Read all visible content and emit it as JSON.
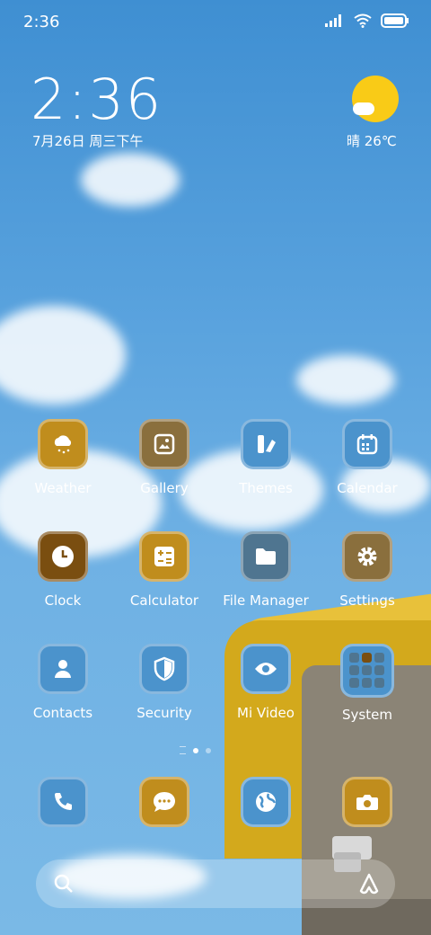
{
  "status_bar": {
    "time": "2:36"
  },
  "clock_widget": {
    "time": "2:36",
    "date": "7月26日 周三下午"
  },
  "weather_widget": {
    "text": "晴 26℃"
  },
  "apps": [
    {
      "label": "Weather",
      "color": "#c08d1d",
      "icon": "cloud-rain-icon"
    },
    {
      "label": "Gallery",
      "color": "#8a6f3d",
      "icon": "image-icon"
    },
    {
      "label": "Themes",
      "color": "#4b93cc",
      "icon": "themes-icon"
    },
    {
      "label": "Calendar",
      "color": "#4b93cc",
      "icon": "calendar-icon"
    },
    {
      "label": "Clock",
      "color": "#7a4e10",
      "icon": "clock-icon"
    },
    {
      "label": "Calculator",
      "color": "#c08d1d",
      "icon": "calculator-icon"
    },
    {
      "label": "File Manager",
      "color": "#4f7590",
      "icon": "folder-icon"
    },
    {
      "label": "Settings",
      "color": "#8a6f3d",
      "icon": "gear-icon"
    },
    {
      "label": "Contacts",
      "color": "#4b93cc",
      "icon": "person-icon"
    },
    {
      "label": "Security",
      "color": "#4b93cc",
      "icon": "shield-icon"
    },
    {
      "label": "Mi Video",
      "color": "#4b93cc",
      "icon": "eye-icon"
    },
    {
      "label": "System",
      "color": "#4b93cc",
      "icon": "folder-grid-icon"
    }
  ],
  "dock": [
    {
      "name": "phone",
      "color": "#4b93cc",
      "icon": "phone-icon"
    },
    {
      "name": "messages",
      "color": "#c08d1d",
      "icon": "chat-icon"
    },
    {
      "name": "browser",
      "color": "#4b93cc",
      "icon": "globe-icon"
    },
    {
      "name": "camera",
      "color": "#c08d1d",
      "icon": "camera-icon"
    }
  ],
  "page_indicator": {
    "count": 2,
    "active": 1
  }
}
